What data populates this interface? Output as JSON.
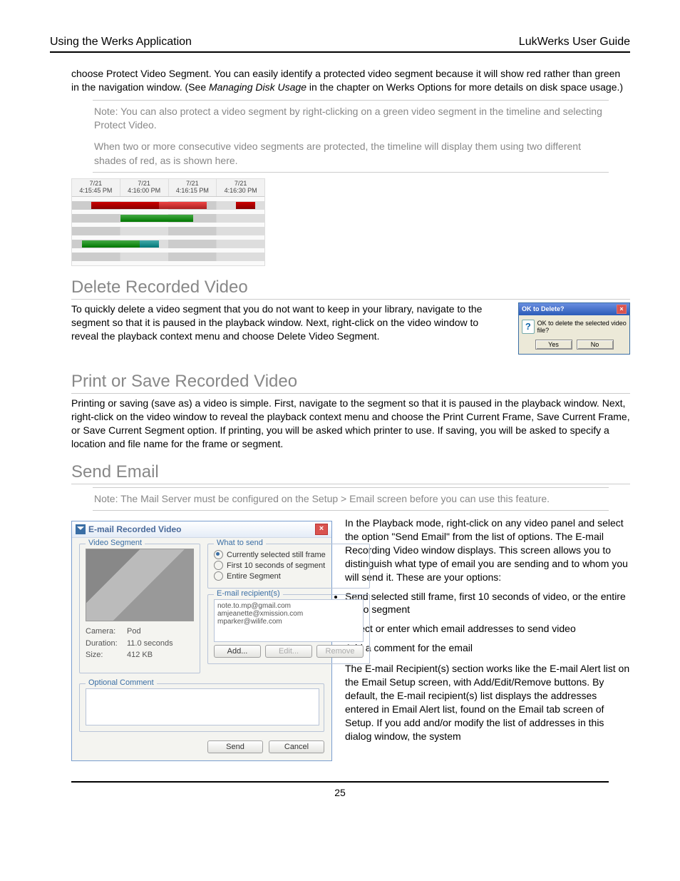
{
  "header": {
    "left": "Using the Werks Application",
    "right": "LukWerks User Guide"
  },
  "intro": {
    "p1a": "choose Protect Video Segment. You can easily identify a protected video segment because it will show red rather than green in the navigation window. (See ",
    "p1i": "Managing Disk Usage",
    "p1b": " in the chapter on Werks Options for more details on disk space usage.)"
  },
  "note1": {
    "p1": "Note: You can also protect a video segment by right-clicking on a green video segment in the timeline and selecting Protect Video.",
    "p2": "When two or more consecutive video segments are protected, the timeline will display them using two different shades of red, as is shown here."
  },
  "timeline": {
    "cols": [
      {
        "date": "7/21",
        "time": "4:15:45 PM"
      },
      {
        "date": "7/21",
        "time": "4:16:00 PM"
      },
      {
        "date": "7/21",
        "time": "4:16:15 PM"
      },
      {
        "date": "7/21",
        "time": "4:16:30 PM"
      }
    ]
  },
  "delete": {
    "heading": "Delete Recorded Video",
    "p1": "To quickly delete a video segment that you do not want to keep in your library, navigate to the segment so that it is paused in the playback window. Next, right-click on the video window to reveal the playback context menu and choose Delete Video Segment."
  },
  "dlg": {
    "title": "OK to Delete?",
    "msg": "OK to delete the selected video file?",
    "yes": "Yes",
    "no": "No"
  },
  "print": {
    "heading": "Print or Save Recorded Video",
    "p1": "Printing or saving (save as) a video is simple. First, navigate to the segment so that it is paused in the playback window. Next, right-click on the video window to reveal the playback context menu and choose the Print Current Frame, Save Current Frame, or Save Current Segment option. If printing, you will be asked which printer to use. If saving, you will be asked to specify a location and file name for the frame or segment."
  },
  "email": {
    "heading": "Send Email",
    "note": "Note:  The Mail Server must be configured on the Setup > Email screen before you can use this feature.",
    "p1": "In the Playback mode, right-click on any video panel and select the option \"Send Email\" from the list of options.   The E-mail Recording Video window displays.  This screen allows you to distinguish what type of email you are sending and to whom you will send it.  These are your options:",
    "bullets": [
      "Send selected still frame, first 10 seconds of video, or the entire video segment",
      "Select or enter which email addresses to send video",
      "Add a comment for the email"
    ],
    "p2": "The E-mail Recipient(s) section works like the E-mail Alert list on the Email Setup screen, with Add/Edit/Remove buttons.  By default, the E-mail recipient(s) list displays the addresses entered in Email Alert list, found on the Email tab screen of Setup.  If you add and/or modify the list of addresses in this dialog window, the system"
  },
  "emailwin": {
    "title": "E-mail Recorded Video",
    "grp_video": "Video Segment",
    "camera_k": "Camera:",
    "camera_v": "Pod",
    "duration_k": "Duration:",
    "duration_v": "11.0 seconds",
    "size_k": "Size:",
    "size_v": "412 KB",
    "grp_what": "What to send",
    "opt1": "Currently selected still frame",
    "opt2": "First 10 seconds of segment",
    "opt3": "Entire Segment",
    "grp_rec": "E-mail recipient(s)",
    "recipients": "note.to.mp@gmail.com\namjeanette@xmission.com\nmparker@wilife.com",
    "btn_add": "Add...",
    "btn_edit": "Edit...",
    "btn_remove": "Remove",
    "grp_comment": "Optional Comment",
    "btn_send": "Send",
    "btn_cancel": "Cancel"
  },
  "page_number": "25"
}
